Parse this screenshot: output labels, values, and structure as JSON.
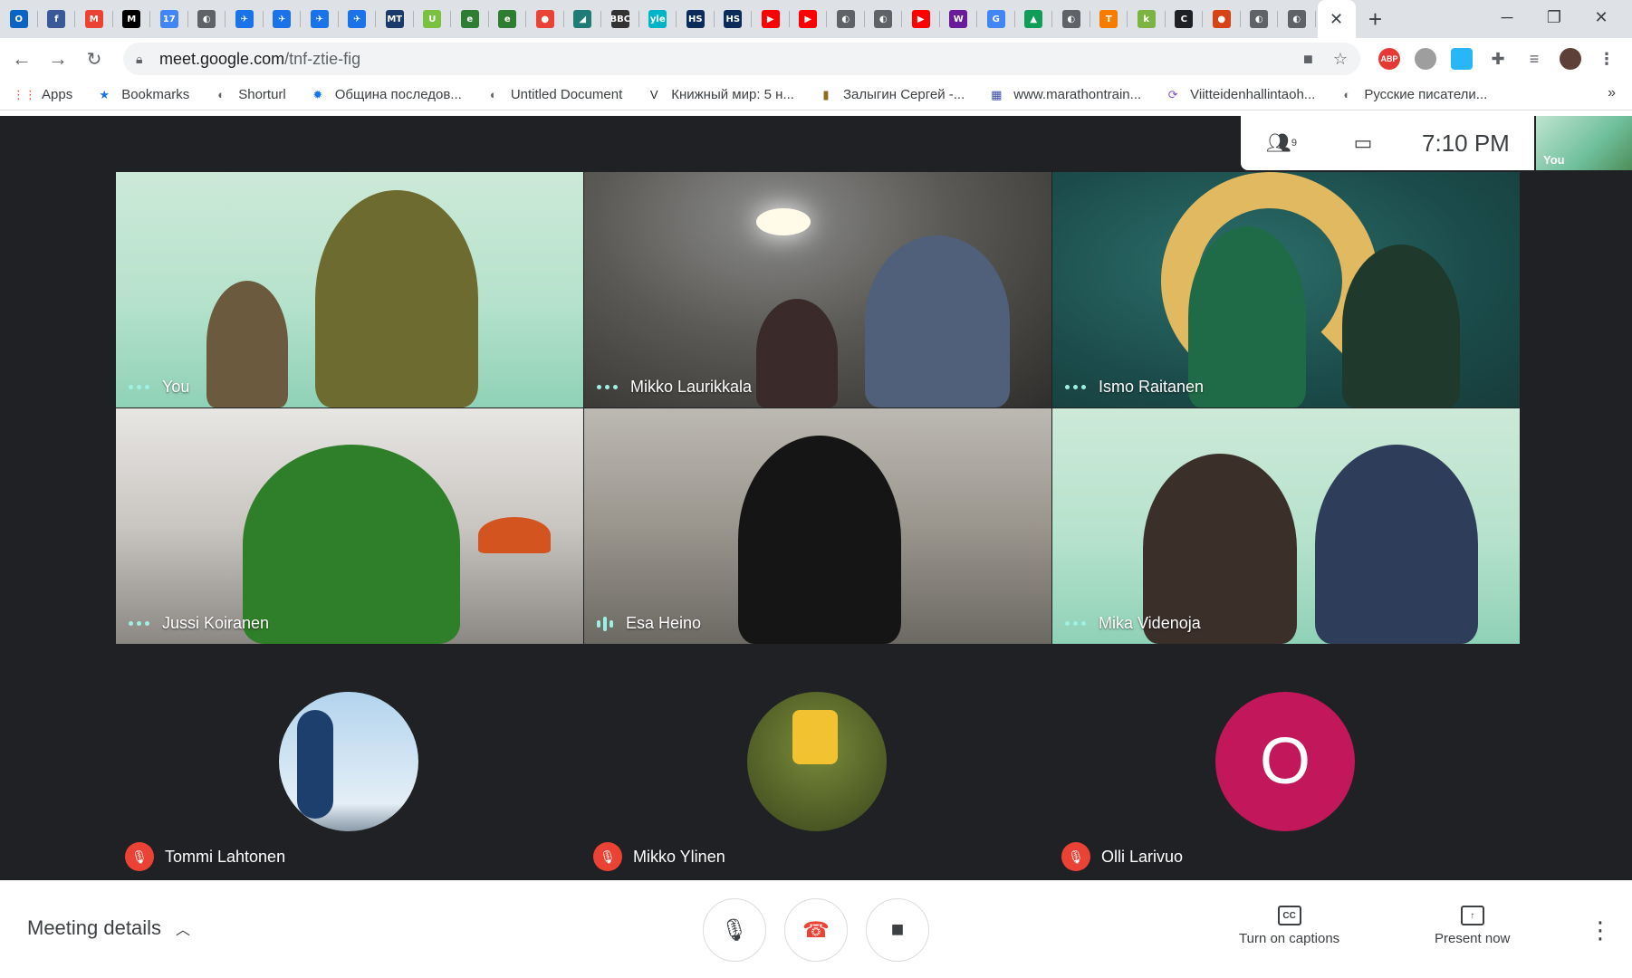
{
  "browser": {
    "tab_favicons": [
      {
        "name": "outlook",
        "text": "O",
        "color": "#0a64c2"
      },
      {
        "name": "facebook",
        "text": "f",
        "color": "#3b5998"
      },
      {
        "name": "gmail",
        "text": "M",
        "color": "#ea4335"
      },
      {
        "name": "medium",
        "text": "M",
        "color": "#000000"
      },
      {
        "name": "calendar",
        "text": "17",
        "color": "#4285f4"
      },
      {
        "name": "globe",
        "text": "◐",
        "color": "#5f6368"
      },
      {
        "name": "kiwi1",
        "text": "✈",
        "color": "#1a73e8"
      },
      {
        "name": "kiwi2",
        "text": "✈",
        "color": "#1a73e8"
      },
      {
        "name": "kiwi3",
        "text": "✈",
        "color": "#1a73e8"
      },
      {
        "name": "kiwi4",
        "text": "✈",
        "color": "#1a73e8"
      },
      {
        "name": "mt",
        "text": "MT",
        "color": "#1a3a6b"
      },
      {
        "name": "u",
        "text": "U",
        "color": "#7ac142"
      },
      {
        "name": "ecoc1",
        "text": "e",
        "color": "#2e7d32"
      },
      {
        "name": "ecoc2",
        "text": "e",
        "color": "#2e7d32"
      },
      {
        "name": "maps",
        "text": "●",
        "color": "#ea4335"
      },
      {
        "name": "slack",
        "text": "◢",
        "color": "#1e7b75"
      },
      {
        "name": "bbc",
        "text": "BBC",
        "color": "#333333"
      },
      {
        "name": "yle",
        "text": "yle",
        "color": "#00b4c8"
      },
      {
        "name": "hs1",
        "text": "HS",
        "color": "#0b2c5a"
      },
      {
        "name": "hs2",
        "text": "HS",
        "color": "#0b2c5a"
      },
      {
        "name": "yt1",
        "text": "▶",
        "color": "#ff0000"
      },
      {
        "name": "yt2",
        "text": "▶",
        "color": "#ff0000"
      },
      {
        "name": "globe2",
        "text": "◐",
        "color": "#5f6368"
      },
      {
        "name": "globe3",
        "text": "◐",
        "color": "#5f6368"
      },
      {
        "name": "yt3",
        "text": "▶",
        "color": "#ff0000"
      },
      {
        "name": "w",
        "text": "W",
        "color": "#6a1b9a"
      },
      {
        "name": "translate",
        "text": "G",
        "color": "#4285f4"
      },
      {
        "name": "drive",
        "text": "▲",
        "color": "#0f9d58"
      },
      {
        "name": "globe4",
        "text": "◐",
        "color": "#5f6368"
      },
      {
        "name": "t",
        "text": "T",
        "color": "#f57c00"
      },
      {
        "name": "k",
        "text": "k",
        "color": "#7cb342"
      },
      {
        "name": "c",
        "text": "C",
        "color": "#202124"
      },
      {
        "name": "ball",
        "text": "●",
        "color": "#d84315"
      },
      {
        "name": "globe5",
        "text": "◐",
        "color": "#5f6368"
      },
      {
        "name": "globe6",
        "text": "◐",
        "color": "#5f6368"
      }
    ],
    "active_tab_close": "✕",
    "new_tab": "+",
    "url_host": "meet.google.com",
    "url_path": "/tnf-ztie-fig",
    "extensions": [
      "ABP"
    ],
    "bookmarks": [
      {
        "label": "Apps",
        "icon": "apps-icon"
      },
      {
        "label": "Bookmarks",
        "icon": "star-icon"
      },
      {
        "label": "Shorturl",
        "icon": "globe-icon"
      },
      {
        "label": "Община последов...",
        "icon": "gear-icon"
      },
      {
        "label": "Untitled Document",
        "icon": "globe-icon"
      },
      {
        "label": "Книжный мир: 5 н...",
        "icon": "v-icon"
      },
      {
        "label": "Залыгин Сергей -...",
        "icon": "book-icon"
      },
      {
        "label": "www.marathontrain...",
        "icon": "grid-icon"
      },
      {
        "label": "Viitteidenhallintaoh...",
        "icon": "link-icon"
      },
      {
        "label": "Русские писатели...",
        "icon": "globe-icon"
      }
    ],
    "bookmarks_overflow": "»"
  },
  "meet": {
    "clock": "7:10 PM",
    "people_count": "9",
    "self_label": "You",
    "tiles": [
      {
        "name": "You",
        "indicator": "dots"
      },
      {
        "name": "Mikko Laurikkala",
        "indicator": "dots"
      },
      {
        "name": "Ismo Raitanen",
        "indicator": "dots"
      },
      {
        "name": "Jussi Koiranen",
        "indicator": "dots"
      },
      {
        "name": "Esa Heino",
        "indicator": "bars"
      },
      {
        "name": "Mika Videnoja",
        "indicator": "dots"
      }
    ],
    "avatar_tiles": [
      {
        "name": "Tommi Lahtonen",
        "muted": true
      },
      {
        "name": "Mikko Ylinen",
        "muted": true
      },
      {
        "name": "Olli Larivuo",
        "muted": true,
        "initial": "O",
        "color": "#c2185b"
      }
    ],
    "bottom": {
      "meeting_details": "Meeting details",
      "captions_label": "Turn on captions",
      "captions_icon_text": "CC",
      "present_label": "Present now"
    }
  }
}
